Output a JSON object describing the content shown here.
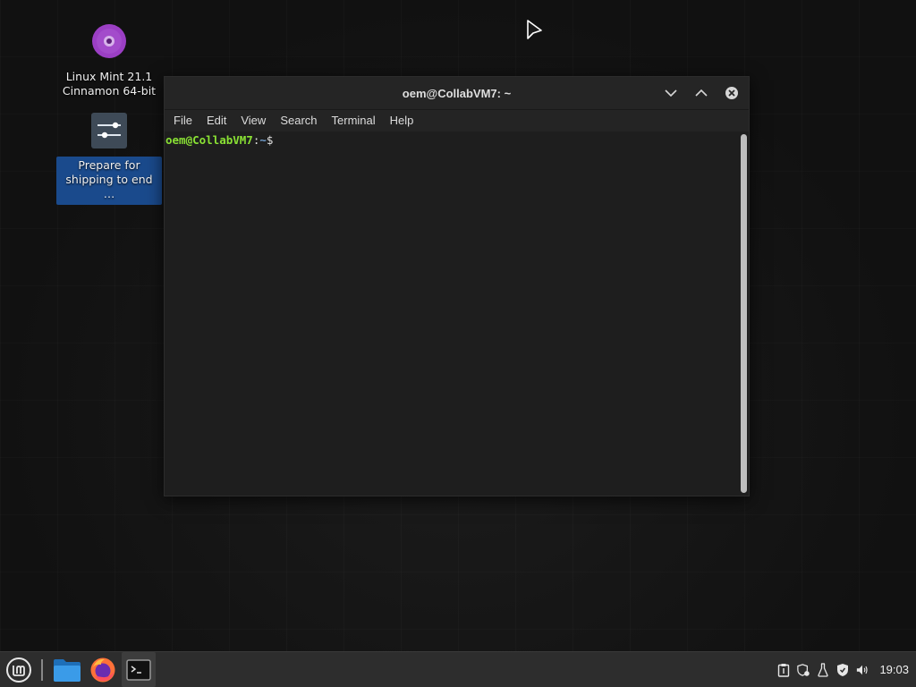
{
  "desktop": {
    "icons": [
      {
        "label": "Linux Mint 21.1\nCinnamon 64-bit",
        "line1": "Linux Mint 21.1",
        "line2": "Cinnamon 64-bit",
        "icon": "dvd-disc-icon"
      },
      {
        "label": "Prepare for shipping to end ...",
        "line1": "Prepare for",
        "line2": "shipping to end …",
        "icon": "sliders-icon",
        "selected": true
      }
    ]
  },
  "window": {
    "title": "oem@CollabVM7: ~",
    "menu": [
      "File",
      "Edit",
      "View",
      "Search",
      "Terminal",
      "Help"
    ],
    "prompt": {
      "user": "oem@CollabVM7",
      "sep": ":",
      "path": "~",
      "symbol": "$"
    }
  },
  "taskbar": {
    "launchers": [
      {
        "name": "menu",
        "icon": "mint-logo-icon"
      },
      {
        "name": "files",
        "icon": "folder-icon"
      },
      {
        "name": "firefox",
        "icon": "firefox-icon"
      },
      {
        "name": "terminal",
        "icon": "terminal-icon",
        "active": true
      }
    ],
    "tray_icons": [
      "clipboard-icon",
      "update-shield-icon",
      "flask-icon",
      "shield-icon",
      "volume-icon"
    ],
    "clock": "19:03"
  },
  "colors": {
    "prompt_user": "#8ae234",
    "prompt_path": "#729fcf",
    "selection": "#1a4a8c",
    "dvd_purple": "#9b3fc4"
  }
}
